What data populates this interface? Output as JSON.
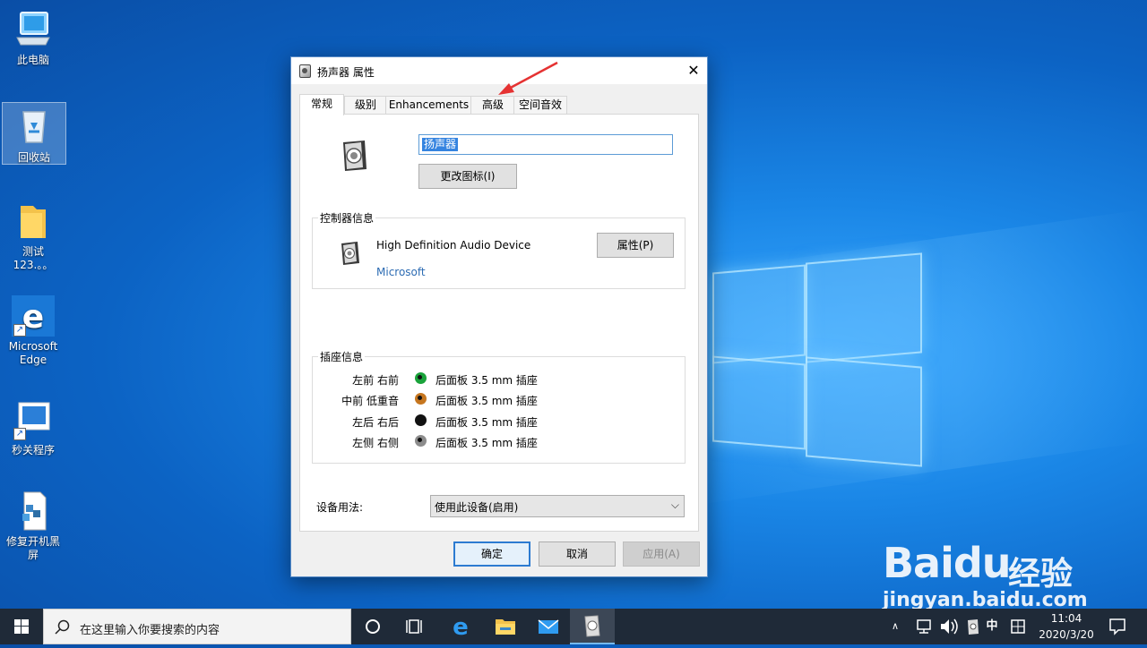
{
  "desktop": {
    "icons": [
      {
        "label": "此电脑",
        "icon": "this-pc-icon"
      },
      {
        "label": "回收站",
        "icon": "recycle-bin-icon"
      },
      {
        "label": "测试123.。。",
        "icon": "folder-icon"
      },
      {
        "label": "Microsoft Edge",
        "icon": "edge-icon"
      },
      {
        "label": "秒关程序",
        "icon": "app-shortcut-icon"
      },
      {
        "label": "修复开机黑屏",
        "icon": "repair-script-icon"
      }
    ]
  },
  "dialog": {
    "title": "扬声器 属性",
    "close_glyph": "✕",
    "tabs": [
      "常规",
      "级别",
      "Enhancements",
      "高级",
      "空间音效"
    ],
    "active_tab": "常规",
    "device_name_value": "扬声器",
    "change_icon_button": "更改图标(I)",
    "controller": {
      "legend": "控制器信息",
      "device": "High Definition Audio Device",
      "manufacturer": "Microsoft",
      "properties_button": "属性(P)"
    },
    "jack": {
      "legend": "插座信息",
      "rows": [
        {
          "label": "左前 右前",
          "desc": "后面板 3.5 mm 插座",
          "color": "#1aa33b"
        },
        {
          "label": "中前 低重音",
          "desc": "后面板 3.5 mm 插座",
          "color": "#c6761f"
        },
        {
          "label": "左后 右后",
          "desc": "后面板 3.5 mm 插座",
          "color": "#111111"
        },
        {
          "label": "左侧 右侧",
          "desc": "后面板 3.5 mm 插座",
          "color": "#8c8c8c"
        }
      ]
    },
    "usage": {
      "label": "设备用法:",
      "value": "使用此设备(启用)"
    },
    "buttons": {
      "ok": "确定",
      "cancel": "取消",
      "apply": "应用(A)"
    }
  },
  "watermark": {
    "brand": "Baidu",
    "cn": "经验",
    "url": "jingyan.baidu.com"
  },
  "taskbar": {
    "search_placeholder": "在这里输入你要搜索的内容",
    "ime": "中",
    "time": "11:04",
    "date": "2020/3/20"
  },
  "colors": {
    "accent": "#2c7bd1",
    "taskbar": "#1f2a38",
    "selection": "#3584e0"
  }
}
